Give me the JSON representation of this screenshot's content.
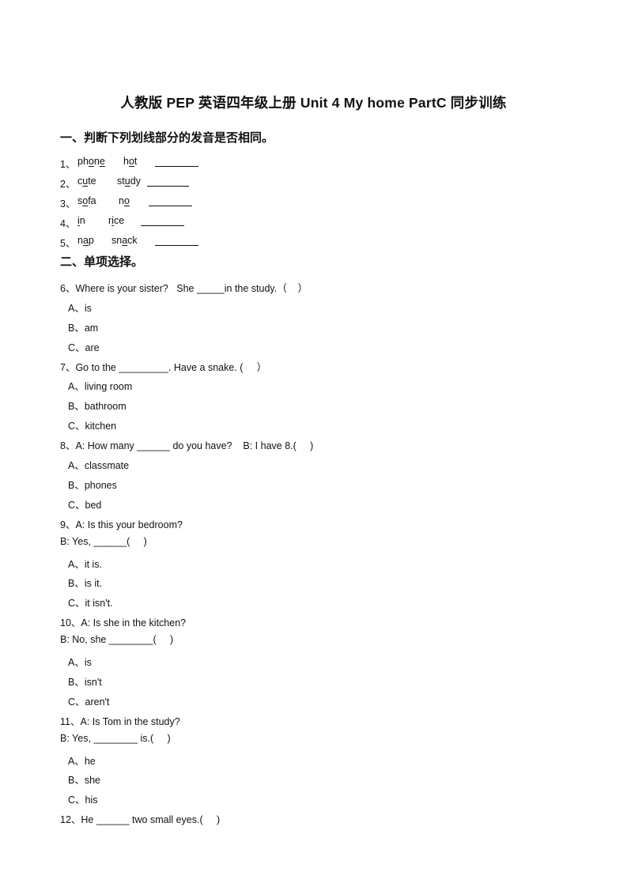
{
  "title": "人教版 PEP 英语四年级上册 Unit 4 My home PartC 同步训练",
  "section1": {
    "heading": "一、判断下列划线部分的发音是否相同。",
    "items": [
      {
        "num": "1、",
        "w1": [
          [
            "ph",
            0
          ],
          [
            "o",
            1
          ],
          [
            "n",
            0
          ],
          [
            "e",
            1
          ]
        ],
        "w2": [
          [
            "h",
            0
          ],
          [
            "o",
            1
          ],
          [
            "t",
            0
          ]
        ]
      },
      {
        "num": "2、",
        "w1": [
          [
            "c",
            0
          ],
          [
            "u",
            1
          ],
          [
            "te",
            0
          ]
        ],
        "w2": [
          [
            "st",
            0
          ],
          [
            "u",
            1
          ],
          [
            "dy",
            0
          ]
        ]
      },
      {
        "num": "3、",
        "w1": [
          [
            "s",
            0
          ],
          [
            "o",
            1
          ],
          [
            "fa",
            0
          ]
        ],
        "w2": [
          [
            "n",
            0
          ],
          [
            "o",
            1
          ]
        ]
      },
      {
        "num": "4、",
        "w1": [
          [
            "i",
            1
          ],
          [
            "n",
            0
          ]
        ],
        "w2": [
          [
            "r",
            0
          ],
          [
            "i",
            1
          ],
          [
            "ce",
            0
          ]
        ]
      },
      {
        "num": "5、",
        "w1": [
          [
            "n",
            0
          ],
          [
            "a",
            1
          ],
          [
            "p",
            0
          ]
        ],
        "w2": [
          [
            "sn",
            0
          ],
          [
            "a",
            1
          ],
          [
            "ck",
            0
          ]
        ]
      }
    ]
  },
  "section2": {
    "heading": "二、单项选择。",
    "questions": [
      {
        "lines": [
          "6、Where is your sister?   She _____in the study.（    ）"
        ],
        "options": [
          "A、is",
          "B、am",
          "C、are"
        ]
      },
      {
        "lines": [
          "7、Go to the _________. Have a snake. (     ）"
        ],
        "options": [
          "A、living room",
          "B、bathroom",
          "C、kitchen"
        ]
      },
      {
        "lines": [
          "8、A: How many ______ do you have?    B: I have 8.(     )"
        ],
        "options": [
          "A、classmate",
          "B、phones",
          "C、bed"
        ]
      },
      {
        "lines": [
          "9、A: Is this your bedroom?",
          "B: Yes, ______(     )"
        ],
        "options": [
          "A、it is.",
          "B、is it.",
          "C、it isn't."
        ]
      },
      {
        "lines": [
          "10、A: Is she in the kitchen?",
          "B: No, she ________(     )"
        ],
        "options": [
          "A、is",
          "B、isn't",
          "C、aren't"
        ]
      },
      {
        "lines": [
          "11、A: Is Tom in the study?",
          "B: Yes, ________ is.(     )"
        ],
        "options": [
          "A、he",
          "B、she",
          "C、his"
        ]
      },
      {
        "lines": [
          "12、He ______ two small eyes.(     )"
        ],
        "options": []
      }
    ]
  }
}
